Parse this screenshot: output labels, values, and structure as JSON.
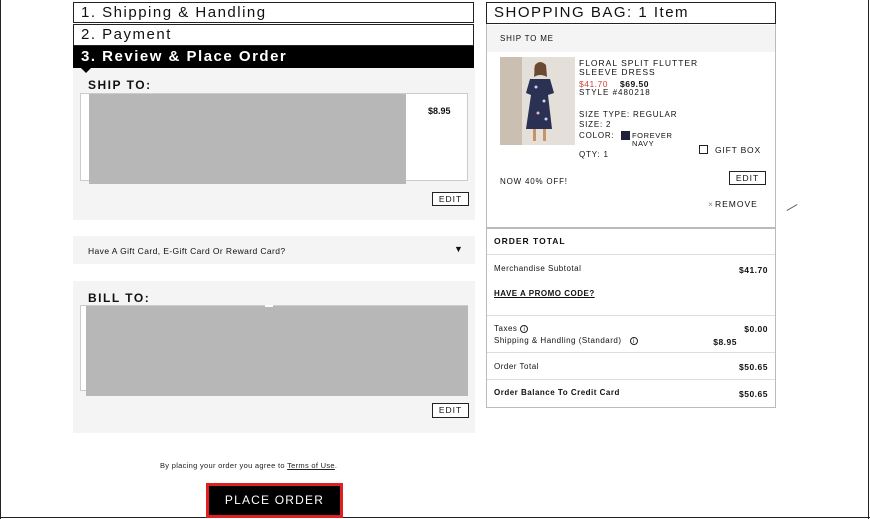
{
  "steps": {
    "step1": "1. Shipping & Handling",
    "step2": "2. Payment",
    "step3": "3. Review & Place Order"
  },
  "ship_to": {
    "label": "SHIP TO:",
    "price": "$8.95",
    "edit_label": "EDIT"
  },
  "gift_card": {
    "text": "Have A Gift Card, E-Gift Card Or Reward Card?",
    "caret": "▼"
  },
  "bill_to": {
    "label": "BILL TO:",
    "edit_label": "EDIT"
  },
  "footer": {
    "terms_prefix": "By placing your order you agree to",
    "terms_link": "Terms of Use",
    "terms_suffix": ".",
    "place_order_label": "PLACE ORDER"
  },
  "bag": {
    "title": "SHOPPING BAG: 1 Item",
    "ship_to_me": "SHIP TO ME",
    "product": {
      "name_line1": "FLORAL SPLIT FLUTTER",
      "name_line2": "SLEEVE DRESS",
      "sale_price": "$41.70",
      "original_price": "$69.50",
      "style": "STYLE #480218",
      "size_type": "SIZE TYPE: REGULAR",
      "size": "SIZE: 2",
      "color_label": "COLOR:",
      "color_line1": "FOREVER",
      "color_line2": "NAVY",
      "qty": "QTY: 1",
      "swatch_color": "#1f2238"
    },
    "gift_box_label": "GIFT BOX",
    "promo_text": "NOW 40% OFF!",
    "edit_label": "EDIT",
    "remove_x": "×",
    "remove_label": "REMOVE"
  },
  "order_total": {
    "title": "ORDER TOTAL",
    "merch_label": "Merchandise Subtotal",
    "merch_value": "$41.70",
    "promo_link": "HAVE A PROMO CODE?",
    "taxes_label": "Taxes",
    "taxes_value": "$0.00",
    "shipping_label": "Shipping & Handling (Standard)",
    "shipping_value": "$8.95",
    "order_total_label": "Order Total",
    "order_total_value": "$50.65",
    "balance_label": "Order Balance To Credit Card",
    "balance_value": "$50.65",
    "info_icon_glyph": "i"
  },
  "colors": {
    "accent_red": "#e02020",
    "sale_red": "#d0403a",
    "panel_gray": "#f4f4f4",
    "redaction_gray": "#b7b7b7"
  }
}
